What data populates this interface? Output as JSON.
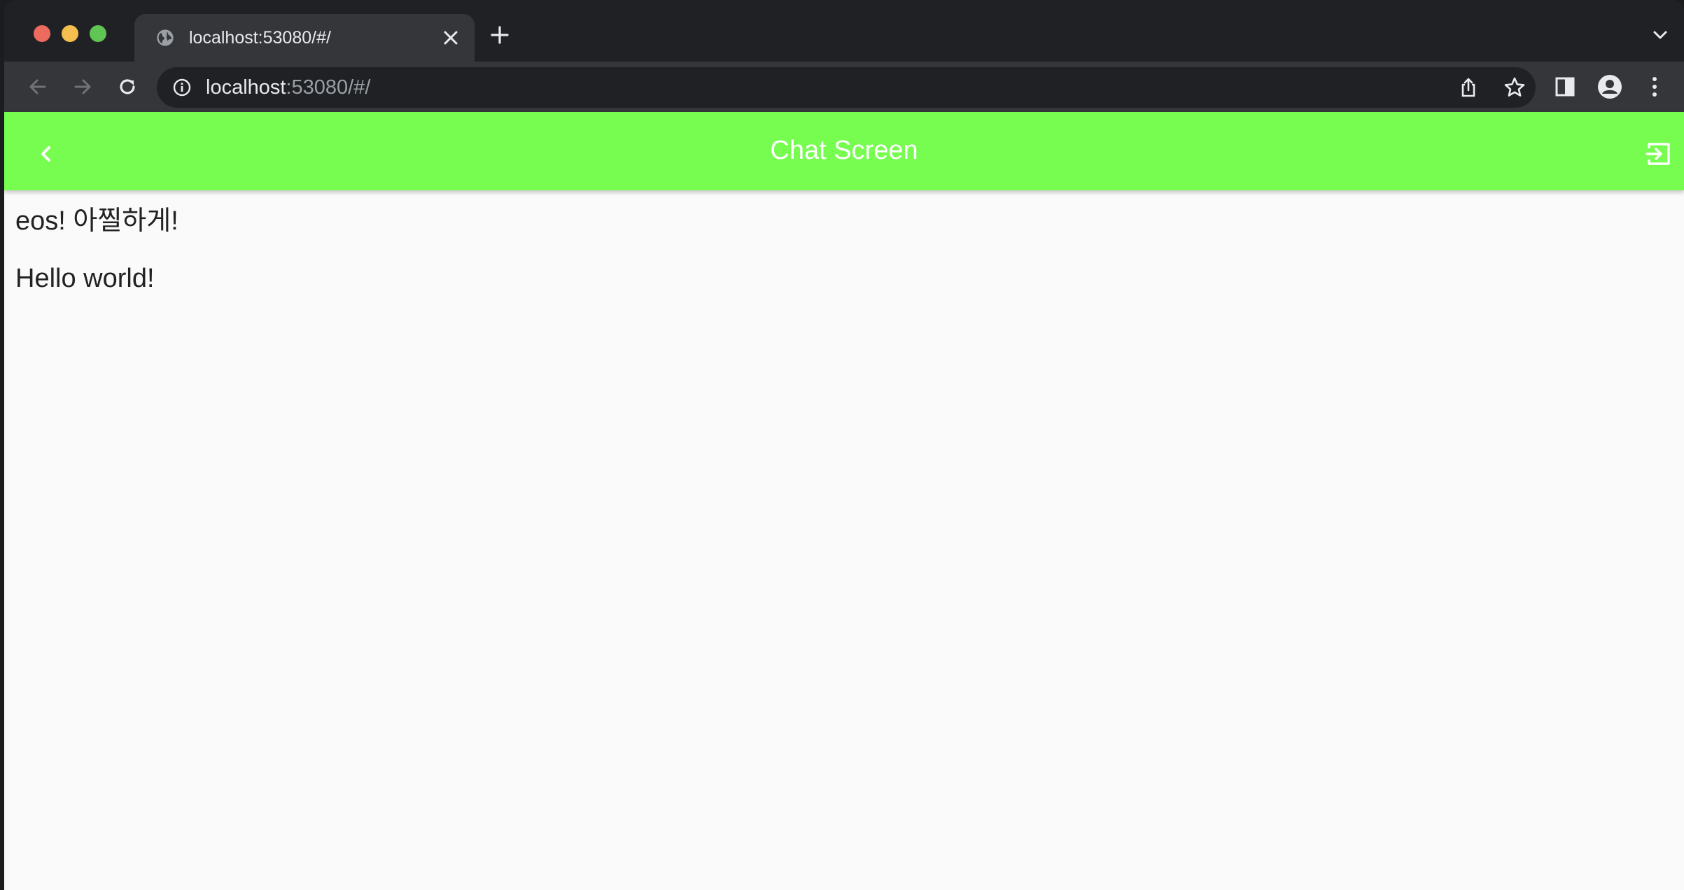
{
  "browser": {
    "tab": {
      "title": "localhost:53080/#/"
    },
    "omnibox": {
      "host": "localhost",
      "rest": ":53080/#/"
    }
  },
  "app": {
    "appbar": {
      "title": "Chat Screen"
    },
    "messages": [
      {
        "text": "eos! 아찔하게!"
      },
      {
        "text": "Hello world!"
      }
    ]
  },
  "colors": {
    "appbar_accent": "#77fc50",
    "page_background": "#fafafa",
    "browser_chrome": "#202124"
  },
  "icons": {
    "tab_favicon": "globe-icon",
    "back": "chevron-left-icon",
    "exit": "exit-to-app-icon"
  }
}
